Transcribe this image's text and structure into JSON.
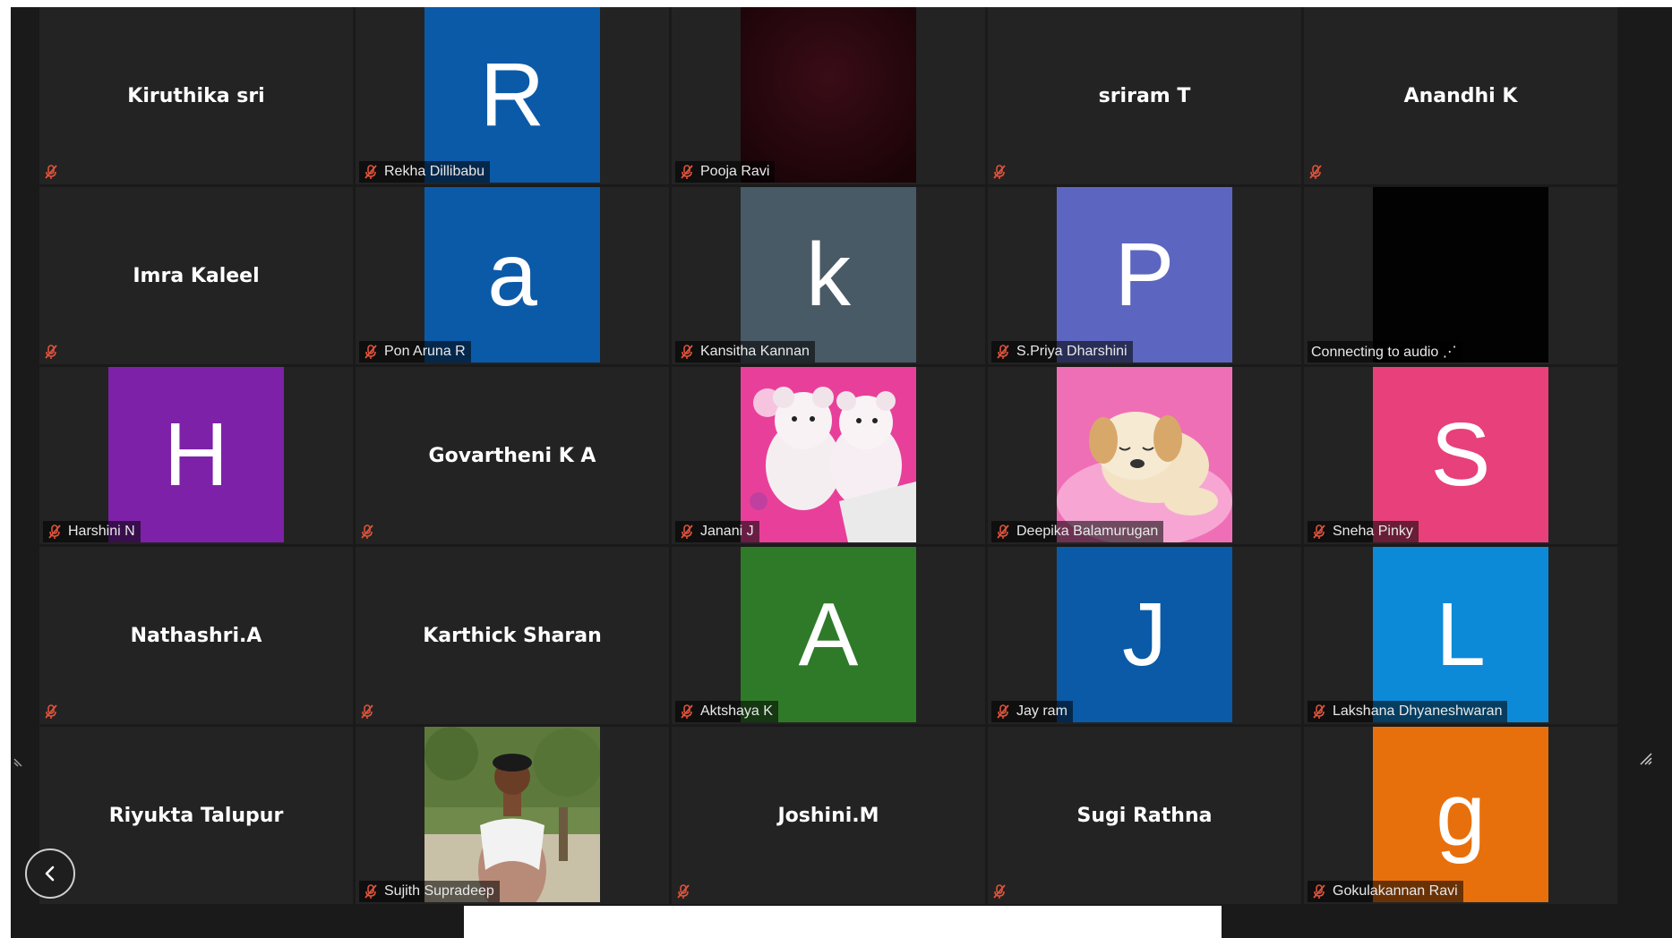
{
  "participants": [
    {
      "name": "Kiruthika sri",
      "type": "name",
      "label": ""
    },
    {
      "name": "Rekha Dillibabu",
      "type": "avatar",
      "initial": "R",
      "color": "#0b5aa8",
      "label": "Rekha Dillibabu"
    },
    {
      "name": "Pooja Ravi",
      "type": "photo-dark-red",
      "label": "Pooja Ravi"
    },
    {
      "name": "sriram T",
      "type": "name",
      "label": ""
    },
    {
      "name": "Anandhi K",
      "type": "name",
      "label": ""
    },
    {
      "name": "Imra Kaleel",
      "type": "name",
      "label": ""
    },
    {
      "name": "Pon Aruna R",
      "type": "avatar",
      "initial": "a",
      "color": "#0b5aa8",
      "label": "Pon Aruna R"
    },
    {
      "name": "Kansitha Kannan",
      "type": "avatar",
      "initial": "k",
      "color": "#485a66",
      "label": "Kansitha Kannan"
    },
    {
      "name": "S.Priya Dharshini",
      "type": "avatar",
      "initial": "P",
      "color": "#5c66c0",
      "label": "S.Priya Dharshini"
    },
    {
      "name": "Connecting to audio",
      "type": "photo-black",
      "label": "Connecting to audio ⋰"
    },
    {
      "name": "Harshini N",
      "type": "avatar",
      "initial": "H",
      "color": "#7d22a8",
      "label": "Harshini N"
    },
    {
      "name": "Govartheni K A",
      "type": "name",
      "label": ""
    },
    {
      "name": "Janani J",
      "type": "photo-teddy",
      "label": "Janani J"
    },
    {
      "name": "Deepika Balamurugan",
      "type": "photo-puppy",
      "label": "Deepika Balamurugan"
    },
    {
      "name": "Sneha Pinky",
      "type": "avatar",
      "initial": "S",
      "color": "#e8407a",
      "label": "Sneha Pinky"
    },
    {
      "name": "Nathashri.A",
      "type": "name",
      "label": ""
    },
    {
      "name": "Karthick Sharan",
      "type": "name",
      "label": ""
    },
    {
      "name": "Aktshaya K",
      "type": "avatar",
      "initial": "A",
      "color": "#2f7a28",
      "label": "Aktshaya K"
    },
    {
      "name": "Jay ram",
      "type": "avatar",
      "initial": "J",
      "color": "#0b5aa8",
      "label": "Jay ram"
    },
    {
      "name": "Lakshana Dhyaneshwaran",
      "type": "avatar",
      "initial": "L",
      "color": "#0c8ad8",
      "label": "Lakshana Dhyaneshwaran"
    },
    {
      "name": "Riyukta Talupur",
      "type": "name",
      "label": ""
    },
    {
      "name": "Sujith Supradeep",
      "type": "photo-person",
      "label": "Sujith Supradeep"
    },
    {
      "name": "Joshini.M",
      "type": "name",
      "label": ""
    },
    {
      "name": "Sugi Rathna",
      "type": "name",
      "label": ""
    },
    {
      "name": "Gokulakannan Ravi",
      "type": "avatar",
      "initial": "g",
      "color": "#e8700c",
      "label": "Gokulakannan Ravi"
    }
  ],
  "colors": {
    "background": "#1a1a1a",
    "tile": "#232323",
    "mute_icon": "#e0523a"
  },
  "icons": {
    "mute": "mic-off-icon",
    "previous": "chevron-left-icon",
    "resize": "resize-grip-icon"
  }
}
